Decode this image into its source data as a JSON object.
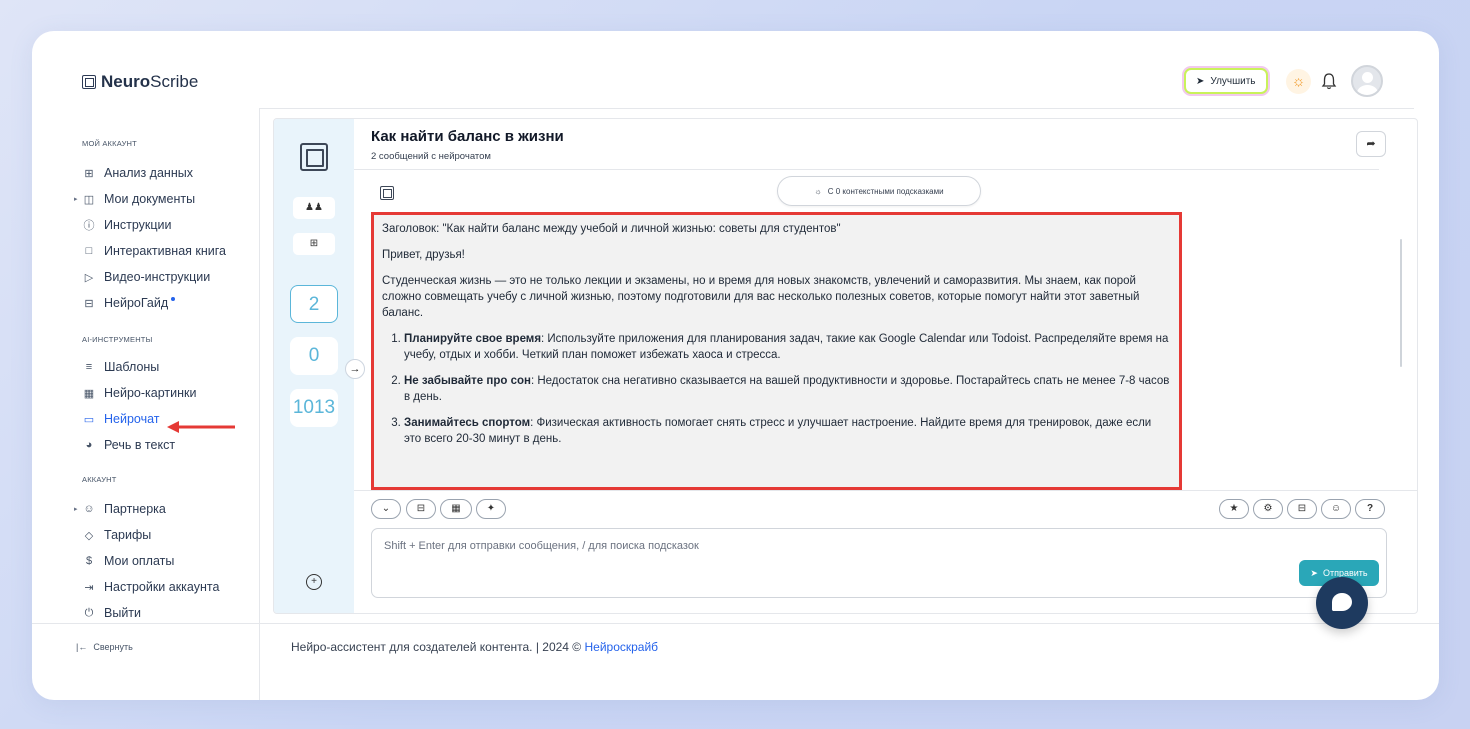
{
  "app": {
    "brand_bold": "Neuro",
    "brand_rest": "Scribe"
  },
  "header": {
    "upgrade_label": "Улучшить"
  },
  "sidebar": {
    "section_account": "МОЙ АККАУНТ",
    "section_ai": "AI-ИНСТРУМЕНТЫ",
    "section_acc2": "АККАУНТ",
    "items": [
      {
        "label": "Анализ данных",
        "icon": "grid-icon"
      },
      {
        "label": "Мои документы",
        "icon": "document-icon"
      },
      {
        "label": "Инструкции",
        "icon": "help-icon"
      },
      {
        "label": "Интерактивная книга",
        "icon": "book-icon"
      },
      {
        "label": "Видео-инструкции",
        "icon": "video-icon"
      },
      {
        "label": "НейроГайд",
        "icon": "table-icon"
      },
      {
        "label": "Шаблоны",
        "icon": "layers-icon"
      },
      {
        "label": "Нейро-картинки",
        "icon": "image-icon"
      },
      {
        "label": "Нейрочат",
        "icon": "chat-icon"
      },
      {
        "label": "Речь в текст",
        "icon": "headphones-icon"
      },
      {
        "label": "Партнерка",
        "icon": "users-icon"
      },
      {
        "label": "Тарифы",
        "icon": "tag-icon"
      },
      {
        "label": "Мои оплаты",
        "icon": "dollar-icon"
      },
      {
        "label": "Настройки аккаунта",
        "icon": "login-icon"
      },
      {
        "label": "Выйти",
        "icon": "power-icon"
      }
    ],
    "collapse_label": "Свернуть"
  },
  "left_column": {
    "stats": [
      "2",
      "0",
      "1013"
    ]
  },
  "chat": {
    "title": "Как найти баланс в жизни",
    "subtitle": "2 сообщений с нейрочатом",
    "context_pill": "С 0 контекстными подсказками",
    "message": {
      "heading_line": "Заголовок: \"Как найти баланс между учебой и личной жизнью: советы для студентов\"",
      "greeting": "Привет, друзья!",
      "intro": "Студенческая жизнь — это не только лекции и экзамены, но и время для новых знакомств, увлечений и саморазвития. Мы знаем, как порой сложно совмещать учебу с личной жизнью, поэтому подготовили для вас несколько полезных советов, которые помогут найти этот заветный баланс.",
      "tips": [
        {
          "bold": "Планируйте свое время",
          "text": ": Используйте приложения для планирования задач, такие как Google Calendar или Todoist. Распределяйте время на учебу, отдых и хобби. Четкий план поможет избежать хаоса и стресса."
        },
        {
          "bold": "Не забывайте про сон",
          "text": ": Недостаток сна негативно сказывается на вашей продуктивности и здоровье. Постарайтесь спать не менее 7-8 часов в день."
        },
        {
          "bold": "Занимайтесь спортом",
          "text": ": Физическая активность помогает снять стресс и улучшает настроение. Найдите время для тренировок, даже если это всего 20-30 минут в день."
        }
      ]
    },
    "input_placeholder": "Shift + Enter для отправки сообщения, / для поиска подсказок",
    "send_label": "Отправить"
  },
  "footer": {
    "text": "Нейро-ассистент для создателей контента.  | 2024 © ",
    "link": "Нейроскрайб"
  },
  "colors": {
    "accent": "#2563eb",
    "stat": "#5bb6d9",
    "send": "#2aa7b8",
    "highlight": "#e53935"
  }
}
